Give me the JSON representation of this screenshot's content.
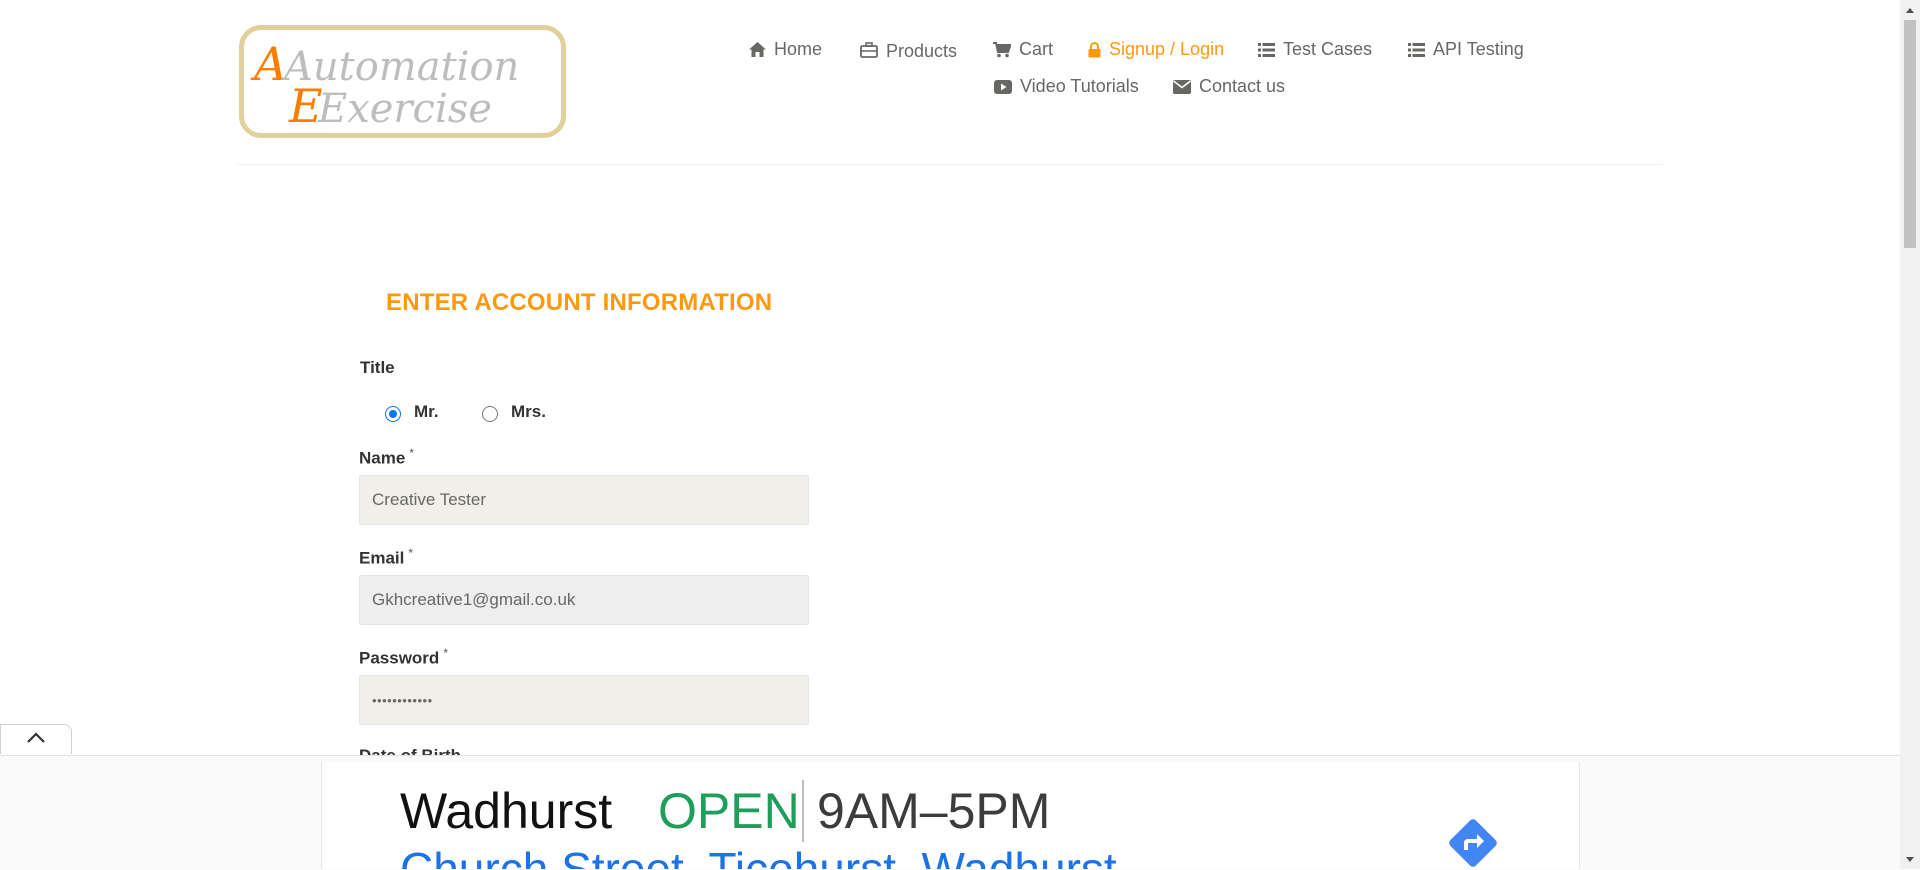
{
  "logo": {
    "line1": "Automation",
    "line2": "Exercise"
  },
  "nav": {
    "home": "Home",
    "products": "Products",
    "cart": "Cart",
    "signup": "Signup / Login",
    "test_cases": "Test Cases",
    "api_testing": "API Testing",
    "video_tutorials": "Video Tutorials",
    "contact": "Contact us"
  },
  "form": {
    "heading": "ENTER ACCOUNT INFORMATION",
    "title_label": "Title",
    "title_options": [
      "Mr.",
      "Mrs."
    ],
    "title_selected": "Mr.",
    "name_label": "Name",
    "name_value": "Creative Tester",
    "email_label": "Email",
    "email_value": "Gkhcreative1@gmail.co.uk",
    "password_label": "Password",
    "password_value": "••••••••••••",
    "required_mark": "*",
    "dob_label": "Date of Birth"
  },
  "ad": {
    "place": "Wadhurst",
    "status": "OPEN",
    "hours": "9AM–5PM",
    "address": "Church Street, Ticehurst, Wadhurst"
  },
  "colors": {
    "accent": "#fe980f",
    "nav_text": "#696763",
    "open_green": "#1e9e5a",
    "link_blue": "#1a73e8",
    "radio_blue": "#0075ff"
  },
  "icons": {
    "home": "home-icon",
    "products": "briefcase-icon",
    "cart": "cart-icon",
    "signup": "lock-icon",
    "test_cases": "list-icon",
    "api_testing": "list-icon",
    "video_tutorials": "youtube-play-icon",
    "contact": "envelope-icon",
    "scroll_up": "chevron-up-icon",
    "directions": "directions-icon"
  }
}
